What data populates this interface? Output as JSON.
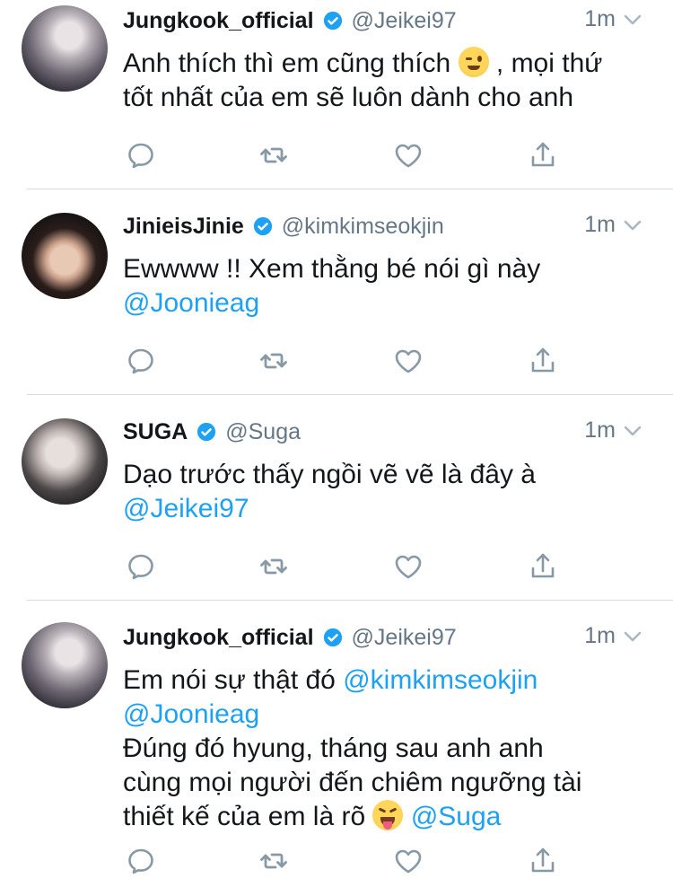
{
  "colors": {
    "name": "#14171a",
    "secondary": "#657786",
    "mention": "#1da1f2",
    "verified": "#1da1f2",
    "divider": "#d6dbdf",
    "icon": "#8899a6"
  },
  "tweets": [
    {
      "display_name": "Jungkook_official",
      "handle": "@Jeikei97",
      "time": "1m",
      "avatar_icon": "profile-photo",
      "lines": [
        {
          "parts": [
            {
              "text": "Anh thích thì em cũng thích "
            },
            {
              "emoji": "winking-face"
            },
            {
              "text": " , mọi thứ"
            }
          ]
        },
        {
          "parts": [
            {
              "text": "tốt nhất của em sẽ luôn dành cho anh"
            }
          ]
        }
      ]
    },
    {
      "display_name": "JinieisJinie",
      "handle": "@kimkimseokjin",
      "time": "1m",
      "avatar_icon": "profile-photo",
      "lines": [
        {
          "parts": [
            {
              "text": "Ewwww !! Xem thằng bé nói gì này"
            }
          ]
        },
        {
          "parts": [
            {
              "mention": "@Joonieag"
            }
          ]
        }
      ]
    },
    {
      "display_name": "SUGA",
      "handle": "@Suga",
      "time": "1m",
      "avatar_icon": "profile-photo",
      "lines": [
        {
          "parts": [
            {
              "text": "Dạo trước thấy ngồi vẽ vẽ là đây à"
            }
          ]
        },
        {
          "parts": [
            {
              "mention": "@Jeikei97"
            }
          ]
        }
      ]
    },
    {
      "display_name": "Jungkook_official",
      "handle": "@Jeikei97",
      "time": "1m",
      "avatar_icon": "profile-photo",
      "lines": [
        {
          "parts": [
            {
              "text": "Em nói sự thật đó "
            },
            {
              "mention": "@kimkimseokjin"
            }
          ]
        },
        {
          "parts": [
            {
              "mention": "@Joonieag"
            }
          ]
        },
        {
          "parts": [
            {
              "text": "Đúng đó hyung, tháng sau anh anh"
            }
          ]
        },
        {
          "parts": [
            {
              "text": "cùng mọi người đến chiêm ngưỡng tài"
            }
          ]
        },
        {
          "parts": [
            {
              "text": "thiết kế của em là rõ "
            },
            {
              "emoji": "face-with-stuck-out-tongue-and-winking-eye"
            },
            {
              "text": " "
            },
            {
              "mention": "@Suga"
            }
          ]
        }
      ]
    }
  ],
  "action_icons": [
    "reply-icon",
    "retweet-icon",
    "like-icon",
    "share-icon"
  ]
}
